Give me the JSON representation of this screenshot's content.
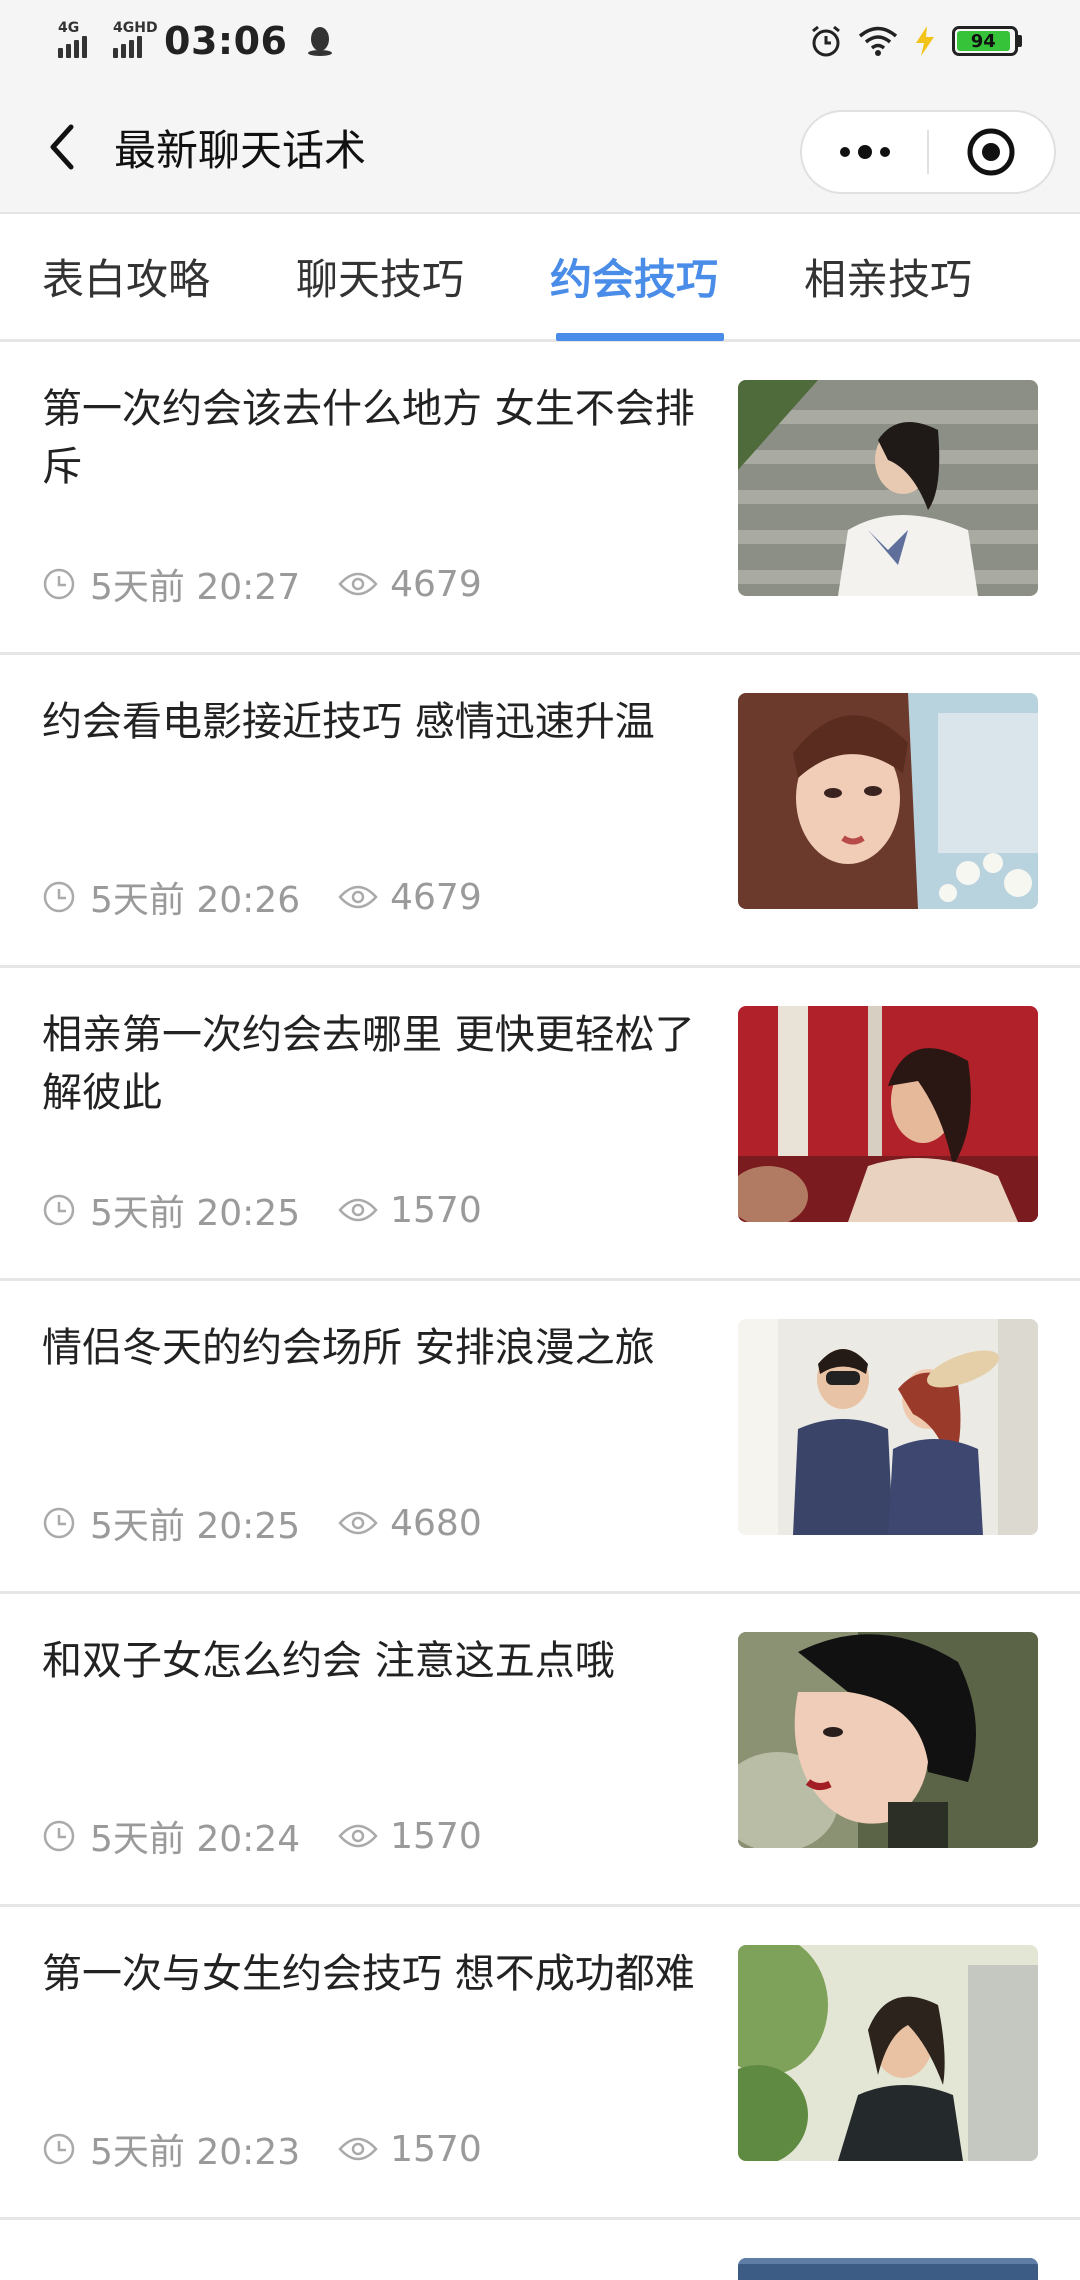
{
  "status_bar": {
    "sim1": "4G",
    "sim2": "4GHD",
    "time": "03:06",
    "battery": "94"
  },
  "nav": {
    "title": "最新聊天话术"
  },
  "tabs": [
    {
      "label": "表白攻略",
      "active": false
    },
    {
      "label": "聊天技巧",
      "active": false
    },
    {
      "label": "约会技巧",
      "active": true
    },
    {
      "label": "相亲技巧",
      "active": false
    }
  ],
  "articles": [
    {
      "title": "第一次约会该去什么地方 女生不会排斥",
      "time": "5天前 20:27",
      "views": "4679",
      "thumb": "girl-on-stairs-photo"
    },
    {
      "title": "约会看电影接近技巧 感情迅速升温",
      "time": "5天前 20:26",
      "views": "4679",
      "thumb": "girl-with-flowers-photo"
    },
    {
      "title": "相亲第一次约会去哪里 更快更轻松了解彼此",
      "time": "5天前 20:25",
      "views": "1570",
      "thumb": "woman-red-room-photo"
    },
    {
      "title": "情侣冬天的约会场所 安排浪漫之旅",
      "time": "5天前 20:25",
      "views": "4680",
      "thumb": "couple-photo"
    },
    {
      "title": "和双子女怎么约会 注意这五点哦",
      "time": "5天前 20:24",
      "views": "1570",
      "thumb": "woman-short-hair-photo"
    },
    {
      "title": "第一次与女生约会技巧 想不成功都难",
      "time": "5天前 20:23",
      "views": "1570",
      "thumb": "woman-sunlight-photo"
    }
  ],
  "colors": {
    "accent": "#4a8de8",
    "meta_text": "#9a9a9a",
    "battery_green": "#36c33a"
  }
}
